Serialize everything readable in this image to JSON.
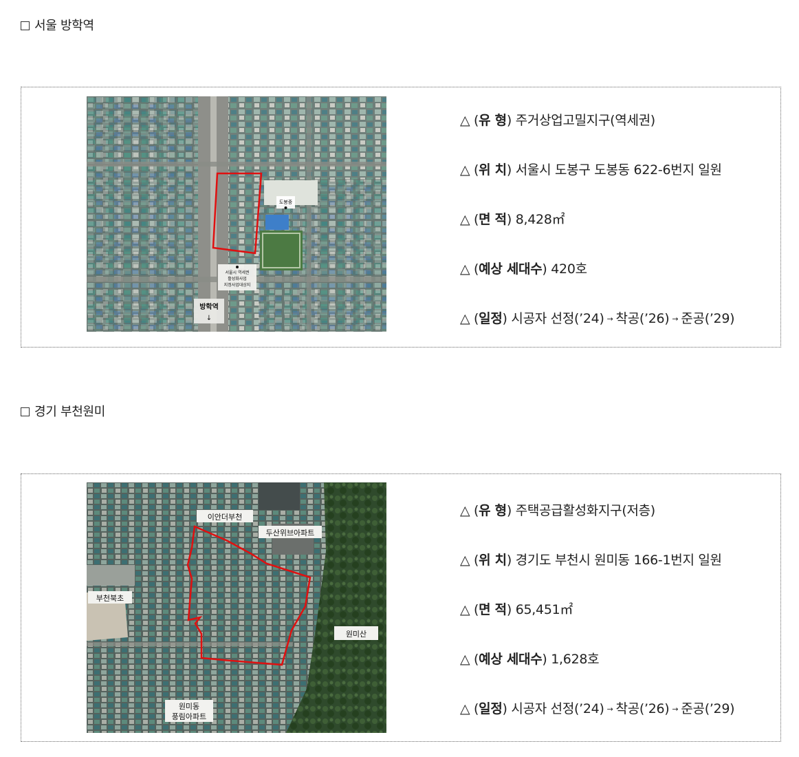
{
  "sections": [
    {
      "title": "서울 방학역",
      "map_labels": {
        "school": "도봉중",
        "notice": [
          "서울시 역세권",
          "활성화사업",
          "지정사업대상지"
        ],
        "station": "방학역",
        "station_arrow": "↓"
      },
      "rows": [
        {
          "label": "유 형",
          "value": "주거상업고밀지구(역세권)"
        },
        {
          "label": "위 치",
          "value": "서울시 도봉구 도봉동 622-6번지 일원"
        },
        {
          "label": "면 적",
          "value": "8,428㎡"
        },
        {
          "label": "예상 세대수",
          "value": "420호"
        },
        {
          "label": "일정",
          "value": "시공자 선정(’24)",
          "step2": "착공(’26)",
          "step3": "준공(’29)"
        }
      ]
    },
    {
      "title": "경기 부천원미",
      "map_labels": {
        "l1": "이안더부천",
        "l2": "두산위브아파트",
        "l3": "부천북초",
        "l4": "원미산",
        "l5a": "원미동",
        "l5b": "풍림아파트"
      },
      "rows": [
        {
          "label": "유 형",
          "value": "주택공급활성화지구(저층)"
        },
        {
          "label": "위 치",
          "value": "경기도 부천시 원미동 166-1번지 일원"
        },
        {
          "label": "면 적",
          "value": "65,451㎡"
        },
        {
          "label": "예상 세대수",
          "value": "1,628호"
        },
        {
          "label": "일정",
          "value": "시공자 선정(’24)",
          "step2": "착공(’26)",
          "step3": "준공(’29)"
        }
      ]
    }
  ],
  "bullet_symbol": "△",
  "arrow_symbol": "→",
  "colors": {
    "boundary": "#e01010",
    "border": "#666666"
  }
}
